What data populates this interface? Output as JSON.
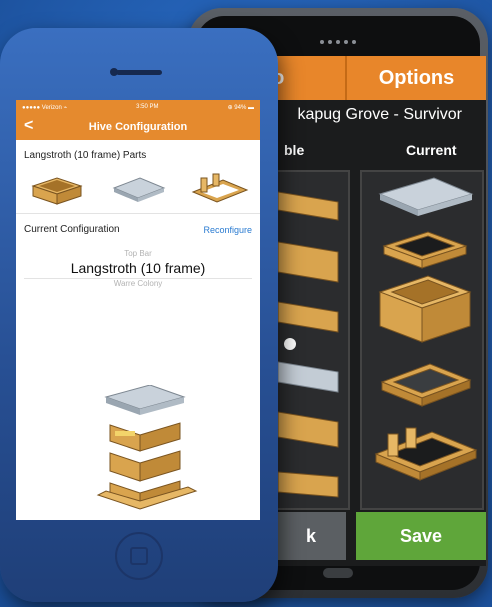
{
  "tablet": {
    "tabs": [
      {
        "label": "lo"
      },
      {
        "label": "Options"
      }
    ],
    "title": "kapug Grove - Survivor",
    "col_left": "ble",
    "col_right": "Current",
    "back_label": "k",
    "save_label": "Save"
  },
  "phone": {
    "status": {
      "carrier": "●●●●● Verizon ⌁",
      "time": "3:50 PM",
      "battery": "⊕ 94% ▬"
    },
    "nav": {
      "back": "<",
      "title": "Hive Configuration"
    },
    "parts_title": "Langstroth (10 frame) Parts",
    "current_config_label": "Current Configuration",
    "reconfigure_label": "Reconfigure",
    "picker": {
      "above": "Top Bar",
      "selected": "Langstroth (10 frame)",
      "below": "Warre Colony"
    }
  },
  "colors": {
    "orange": "#e58a2e",
    "green": "#5fa63a",
    "wood": "#d9a44e"
  }
}
